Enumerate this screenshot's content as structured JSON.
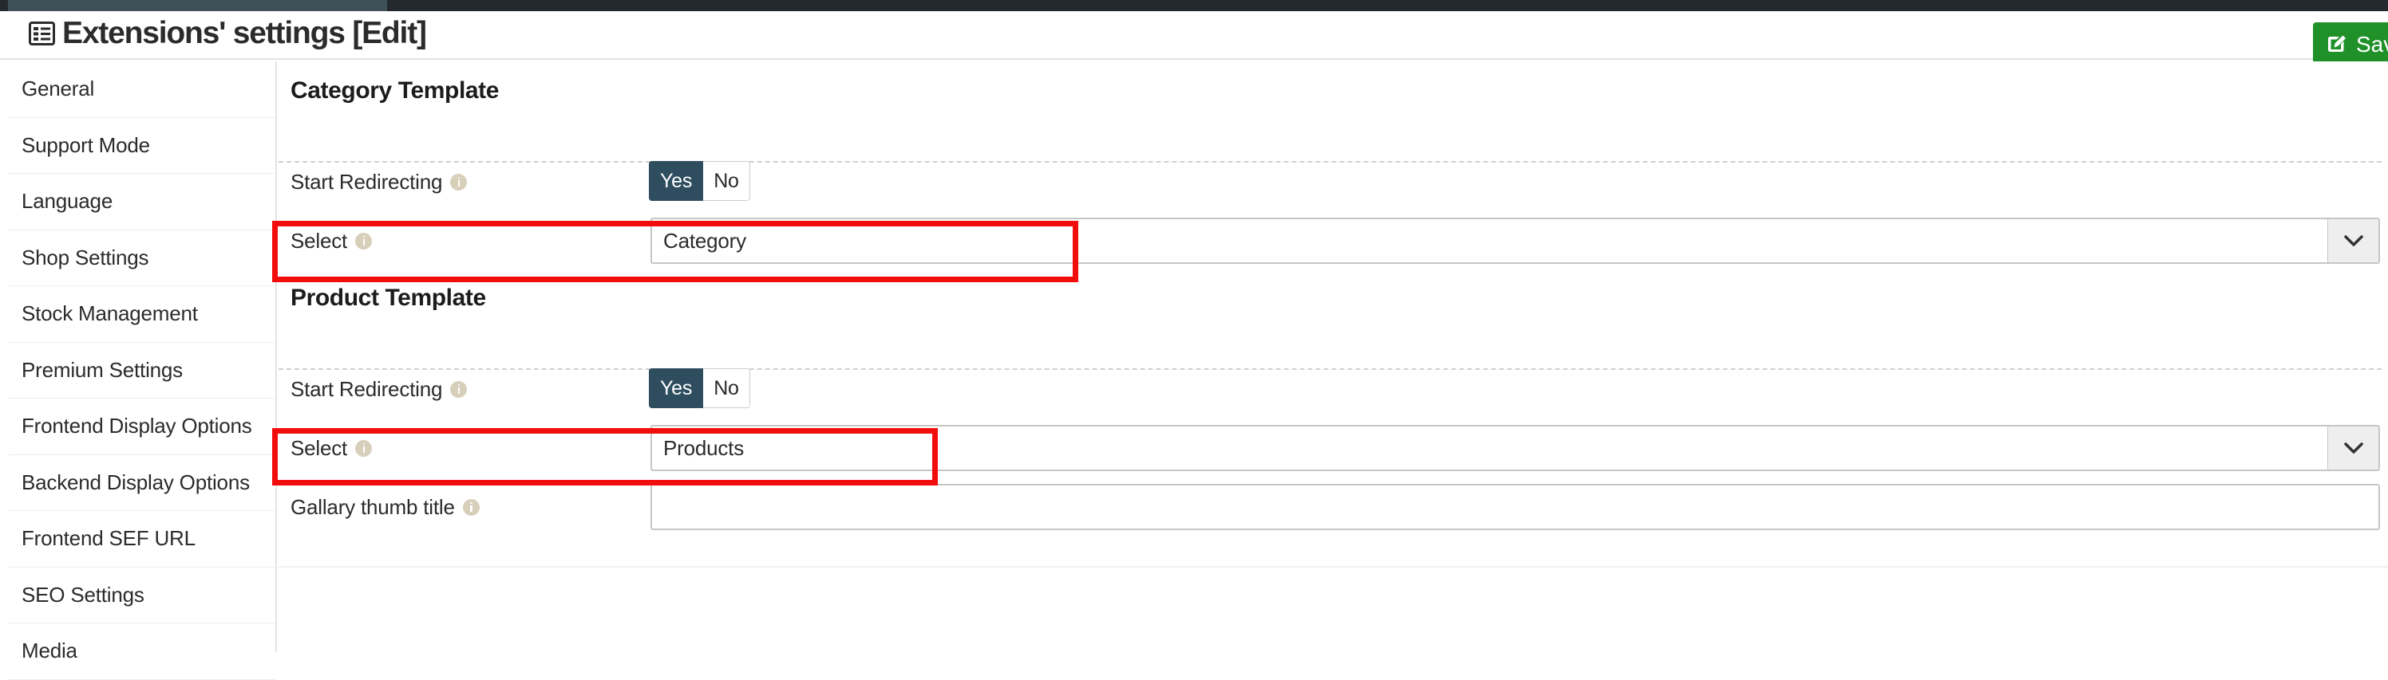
{
  "window": {
    "title": "Extensions' settings [Edit]",
    "title_icon": "list-settings-icon"
  },
  "toolbar": {
    "save_label": "Save",
    "save_icon": "edit-square-icon",
    "save_color": "#1f9128"
  },
  "sidebar": {
    "items": [
      {
        "label": "General"
      },
      {
        "label": "Support Mode"
      },
      {
        "label": "Language"
      },
      {
        "label": "Shop Settings"
      },
      {
        "label": "Stock Management"
      },
      {
        "label": "Premium Settings"
      },
      {
        "label": "Frontend Display Options"
      },
      {
        "label": "Backend Display Options"
      },
      {
        "label": "Frontend SEF URL"
      },
      {
        "label": "SEO Settings"
      },
      {
        "label": "Media"
      }
    ]
  },
  "main": {
    "sections": [
      {
        "heading": "Category Template",
        "redirect_label": "Start Redirecting",
        "redirect_info_icon": "info-icon",
        "toggle_yes": "Yes",
        "toggle_no": "No",
        "toggle_selected": "Yes",
        "select_label": "Select",
        "select_info_icon": "info-icon",
        "select_value": "Category",
        "select_arrow_icon": "chevron-down-icon"
      },
      {
        "heading": "Product Template",
        "redirect_label": "Start Redirecting",
        "redirect_info_icon": "info-icon",
        "toggle_yes": "Yes",
        "toggle_no": "No",
        "toggle_selected": "Yes",
        "select_label": "Select",
        "select_info_icon": "info-icon",
        "select_value": "Products",
        "select_arrow_icon": "chevron-down-icon",
        "gallery_label": "Gallary thumb title",
        "gallery_info_icon": "info-icon",
        "gallery_value": "",
        "gallery_placeholder": ""
      }
    ]
  },
  "annotations": {
    "highlight_color": "#f20d0d",
    "boxes": [
      {
        "target": "category-select-row"
      },
      {
        "target": "product-select-row"
      }
    ]
  }
}
